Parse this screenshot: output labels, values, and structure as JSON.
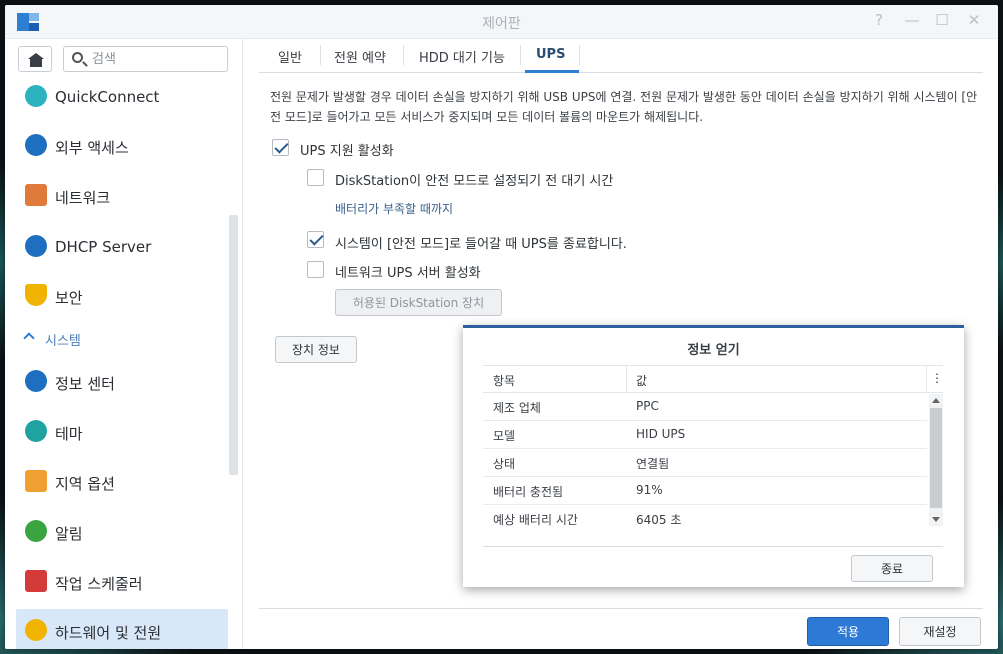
{
  "window": {
    "title": "제어판"
  },
  "window_controls": {
    "help": "?",
    "minimize": "—",
    "maximize": "☐",
    "close": "✕"
  },
  "search": {
    "placeholder": "검색"
  },
  "sidebar": {
    "items": [
      {
        "label": "QuickConnect",
        "icon": "quickconnect-icon",
        "color": "#2bb3c0"
      },
      {
        "label": "외부 액세스",
        "icon": "globe-icon",
        "color": "#1f6fc0"
      },
      {
        "label": "네트워크",
        "icon": "house-network-icon",
        "color": "#e07a3a"
      },
      {
        "label": "DHCP Server",
        "icon": "dhcp-icon",
        "color": "#1f6fc0"
      },
      {
        "label": "보안",
        "icon": "shield-icon",
        "color": "#f0b400"
      }
    ],
    "section": {
      "label": "시스템"
    },
    "system_items": [
      {
        "label": "정보 센터",
        "icon": "info-icon",
        "color": "#1f6fc0"
      },
      {
        "label": "테마",
        "icon": "palette-icon",
        "color": "#1fa3a0"
      },
      {
        "label": "지역 옵션",
        "icon": "map-clock-icon",
        "color": "#f0a030"
      },
      {
        "label": "알림",
        "icon": "chat-icon",
        "color": "#3aa540"
      },
      {
        "label": "작업 스케줄러",
        "icon": "calendar-icon",
        "color": "#d43a3a"
      },
      {
        "label": "하드웨어 및 전원",
        "icon": "bulb-icon",
        "color": "#f0b400",
        "active": true
      }
    ]
  },
  "tabs": [
    {
      "label": "일반"
    },
    {
      "label": "전원 예약"
    },
    {
      "label": "HDD 대기 기능"
    },
    {
      "label": "UPS",
      "active": true
    }
  ],
  "ups": {
    "description": "전원 문제가 발생할 경우 데이터 손실을 방지하기 위해 USB UPS에 연결. 전원 문제가 발생한 동안 데이터 손실을 방지하기 위해 시스템이 [안전 모드]로 들어가고 모든 서비스가 중지되며 모든 데이터 볼륨의 마운트가 해제됩니다.",
    "enable_label": "UPS 지원 활성화",
    "enable_checked": true,
    "safe_mode_wait_label": "DiskStation이 안전 모드로 설정되기 전 대기 시간",
    "safe_mode_wait_checked": false,
    "safe_mode_wait_value": "배터리가 부족할 때까지",
    "shutdown_label": "시스템이 [안전 모드]로 들어갈 때 UPS를 종료합니다.",
    "shutdown_checked": true,
    "network_server_label": "네트워크 UPS 서버 활성화",
    "network_server_checked": false,
    "allowed_devices_button": "허용된 DiskStation 장치",
    "device_info_button": "장치 정보"
  },
  "dialog": {
    "title": "정보 얻기",
    "columns": [
      "항목",
      "값"
    ],
    "rows": [
      {
        "key": "제조 업체",
        "value": "PPC"
      },
      {
        "key": "모델",
        "value": "HID UPS"
      },
      {
        "key": "상태",
        "value": "연결됨"
      },
      {
        "key": "배터리 충전됨",
        "value": "91%"
      },
      {
        "key": "예상 배터리 시간",
        "value": "6405 초"
      }
    ],
    "menu_glyph": "⋮",
    "close_button": "종료"
  },
  "footer": {
    "apply_button": "적용",
    "reset_button": "재설정"
  },
  "colors": {
    "accent": "#2d7ad6",
    "active_nav": "#d9e8f9",
    "dialog_border": "#2d5fa0"
  }
}
